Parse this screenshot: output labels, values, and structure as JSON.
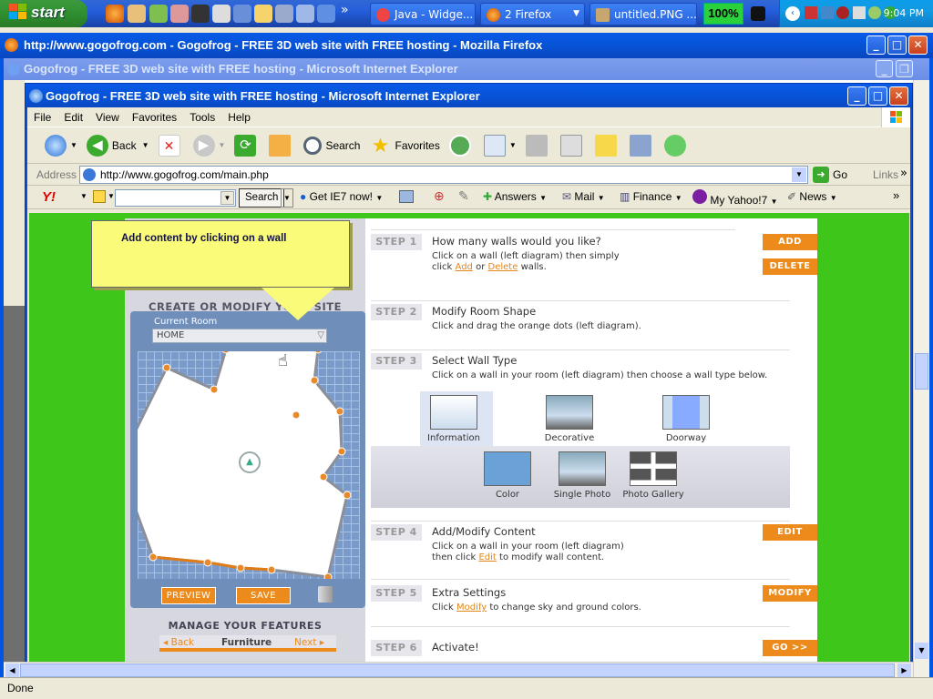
{
  "taskbar": {
    "start_label": "start",
    "tasks": [
      {
        "label": "Java - Widge...",
        "active": false
      },
      {
        "label": "2 Firefox",
        "active": false
      },
      {
        "label": "untitled.PNG ...",
        "active": false
      }
    ],
    "zoom_badge": "100%",
    "clock": "9:04 PM",
    "overflow": "»"
  },
  "firefox_window": {
    "title": "http://www.gogofrog.com - Gogofrog - FREE 3D web site with FREE hosting - Mozilla Firefox"
  },
  "ie_back_window": {
    "title": "Gogofrog - FREE 3D web site with FREE hosting - Microsoft Internet Explorer"
  },
  "ie_window": {
    "title": "Gogofrog - FREE 3D web site with FREE hosting - Microsoft Internet Explorer",
    "menu": [
      "File",
      "Edit",
      "View",
      "Favorites",
      "Tools",
      "Help"
    ],
    "toolbar": {
      "back": "Back",
      "search": "Search",
      "favorites": "Favorites"
    },
    "address": {
      "label": "Address",
      "url": "http://www.gogofrog.com/main.php",
      "go": "Go",
      "links": "Links"
    },
    "yahoo_bar": {
      "search_btn": "Search",
      "get_ie7": "Get IE7 now!",
      "answers": "Answers",
      "mail": "Mail",
      "finance": "Finance",
      "my_yahoo": "My Yahoo!7",
      "news": "News"
    },
    "status": "Done"
  },
  "page": {
    "tooltip": "Add content by clicking on a wall",
    "create_header": "CREATE OR MODIFY YOUR SITE",
    "current_room_label": "Current Room",
    "current_room_value": "HOME",
    "preview_btn": "PREVIEW",
    "save_btn": "SAVE",
    "manage_header": "MANAGE YOUR FEATURES",
    "features_nav": {
      "back": "Back",
      "current": "Furniture",
      "next": "Next"
    },
    "steps": [
      {
        "badge": "STEP 1",
        "title": "How many walls would you like?",
        "desc_pre": "Click on a wall (left diagram) then simply",
        "desc_click": "click",
        "link1": "Add",
        "or": "or",
        "link2": "Delete",
        "desc_post": "walls.",
        "buttons": [
          "ADD",
          "DELETE"
        ]
      },
      {
        "badge": "STEP 2",
        "title": "Modify Room Shape",
        "desc": "Click and drag the orange dots (left diagram)."
      },
      {
        "badge": "STEP 3",
        "title": "Select Wall Type",
        "desc": "Click on a wall in your room (left diagram) then choose a wall type below."
      },
      {
        "badge": "STEP 4",
        "title": "Add/Modify Content",
        "desc_pre": "Click on a wall in your room (left diagram)",
        "desc_then": "then click",
        "link": "Edit",
        "desc_post": "to modify wall content.",
        "button": "EDIT"
      },
      {
        "badge": "STEP 5",
        "title": "Extra Settings",
        "desc_pre": "Click",
        "link": "Modify",
        "desc_post": "to change sky and ground colors.",
        "button": "MODIFY"
      },
      {
        "badge": "STEP 6",
        "title": "Activate!",
        "button": "GO >>"
      }
    ],
    "wall_types": [
      "Information",
      "Decorative",
      "Doorway",
      "Color",
      "Single Photo",
      "Photo Gallery"
    ]
  }
}
